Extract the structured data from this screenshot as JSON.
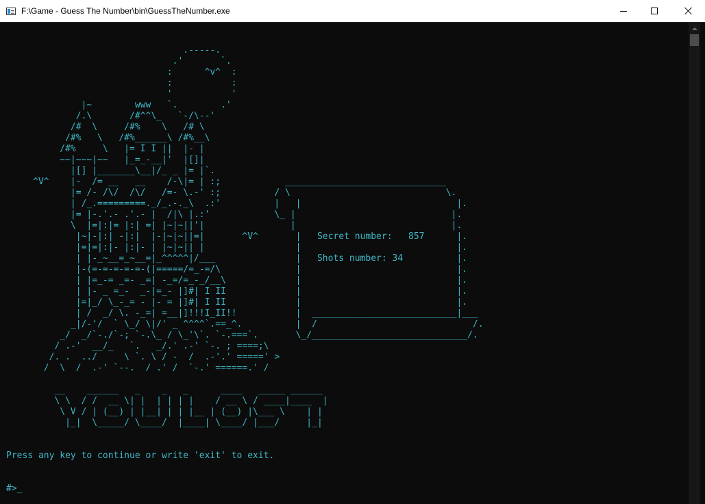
{
  "window": {
    "title": "F:\\Game - Guess The Number\\bin\\GuessTheNumber.exe",
    "icon": "console-app-icon",
    "controls": {
      "minimize_icon": "minimize-icon",
      "maximize_icon": "maximize-icon",
      "close_icon": "close-icon"
    }
  },
  "console": {
    "ascii_art": "                                 .-----.\n                               .'       `.\n                              :      ^v^  :\n                              :           :\n                              '           '\n              |~        www   `.        .'\n             /.\\       /#^^\\_   `-/\\--'\n            /#  \\     /#%    \\   /# \\\n           /#%   \\   /#%______\\ /#%__\\\n          /#%     \\   |= I I ||  |- |\n          ~~|~~~|~~   |_=_-__|'  |[]|\n            |[] |_______\\__|/_ _ |= |`.\n     ^V^    |-  /= __   __    /-\\|= | :;            ______________________________\n            |= /- /\\/  /\\/   /=- \\.-' :;          / \\                             \\.\n            | /_.=========._/_.-._\\  .:'          |   |                             |.\n            |= |-.'.- .'.- |  /|\\ |.:'            \\_ |                             |.\n            \\  |=|:|= |:| =| |~|~||'|                |                             |.\n             |~|-|:| -|:|  |-|~|~||=|       ^V^       |   Secret number:   857      |.\n             |=|=|:|- |:|- | |~|~|| |                 |                             |.\n             | |-_~__=_~__=|_^^^^^|/___               |   Shots number: 34          |.\n             |-(=-=-=-=-=-(|=====/=_-=/\\              |                             |.\n             | |=_-= _=- _=| -_=/=_-_/__\\             |                             |.\n             | |- _ =_-  _-|=_- |]#| I II             |                             |.\n             |=|_/ \\_-_= - |- = |]#| I II             |                             |.\n             | /  _/ \\. -_=| =__|]!!!I_II!!           |  ___________________________|___\n            _|/-'/  ` \\_/ \\|/' _ ^^^^`.==_^.          |  /                             /.\n          _/  _/`-./`-; `-.\\_ / \\_'\\`. `-.===`.       \\_/_____________________________/.\n         / .-'  __/_   `.   _/.' .-' `-. ; ====;\\\n        /. .  ../     \\ `. \\ / -  /  .-'.' =====' >\n       /  \\  /  .-' `--.  / .' /  `-.' ======.' /\n\n         __    ______   _    _   _      ____   _____ ______\n         \\ \\  / /  __ \\| |  | | | |    / __ \\ / ____|____  |\n          \\ V / | (__) | |__| | | |__ | (__) |\\___ \\    | |\n           |_|  \\_____/ \\____/  |____| \\____/ |___/     |_|\n",
    "prompt_message": "Press any key to continue or write 'exit' to exit.",
    "prompt_input": "#>",
    "cursor": "_",
    "secret_number_label": "Secret number:",
    "secret_number_value": "857",
    "shots_number_label": "Shots number:",
    "shots_number_value": "34"
  },
  "colors": {
    "background": "#0c0c0c",
    "text": "#3fb8c8",
    "titlebar": "#ffffff"
  }
}
